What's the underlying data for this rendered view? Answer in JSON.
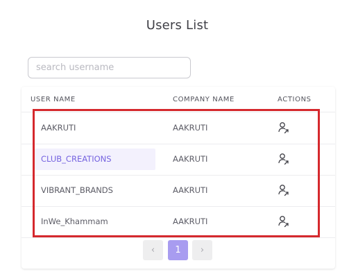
{
  "page": {
    "title": "Users List"
  },
  "search": {
    "placeholder": "search username",
    "value": ""
  },
  "table": {
    "columns": [
      "USER NAME",
      "COMPANY NAME",
      "ACTIONS"
    ],
    "rows": [
      {
        "user": "AAKRUTI",
        "company": "AAKRUTI",
        "action_icon": "user-arrow-icon"
      },
      {
        "user": "CLUB_CREATIONS",
        "company": "AAKRUTI",
        "action_icon": "user-arrow-icon",
        "highlighted": true
      },
      {
        "user": "VIBRANT_BRANDS",
        "company": "AAKRUTI",
        "action_icon": "user-arrow-icon"
      },
      {
        "user": "InWe_Khammam",
        "company": "AAKRUTI",
        "action_icon": "user-arrow-icon"
      }
    ]
  },
  "pagination": {
    "prev": "‹",
    "current": "1",
    "next": "›"
  },
  "colors": {
    "accent": "#a89cf0",
    "highlight_text": "#7563e0",
    "annotation_box": "#d5282d"
  }
}
